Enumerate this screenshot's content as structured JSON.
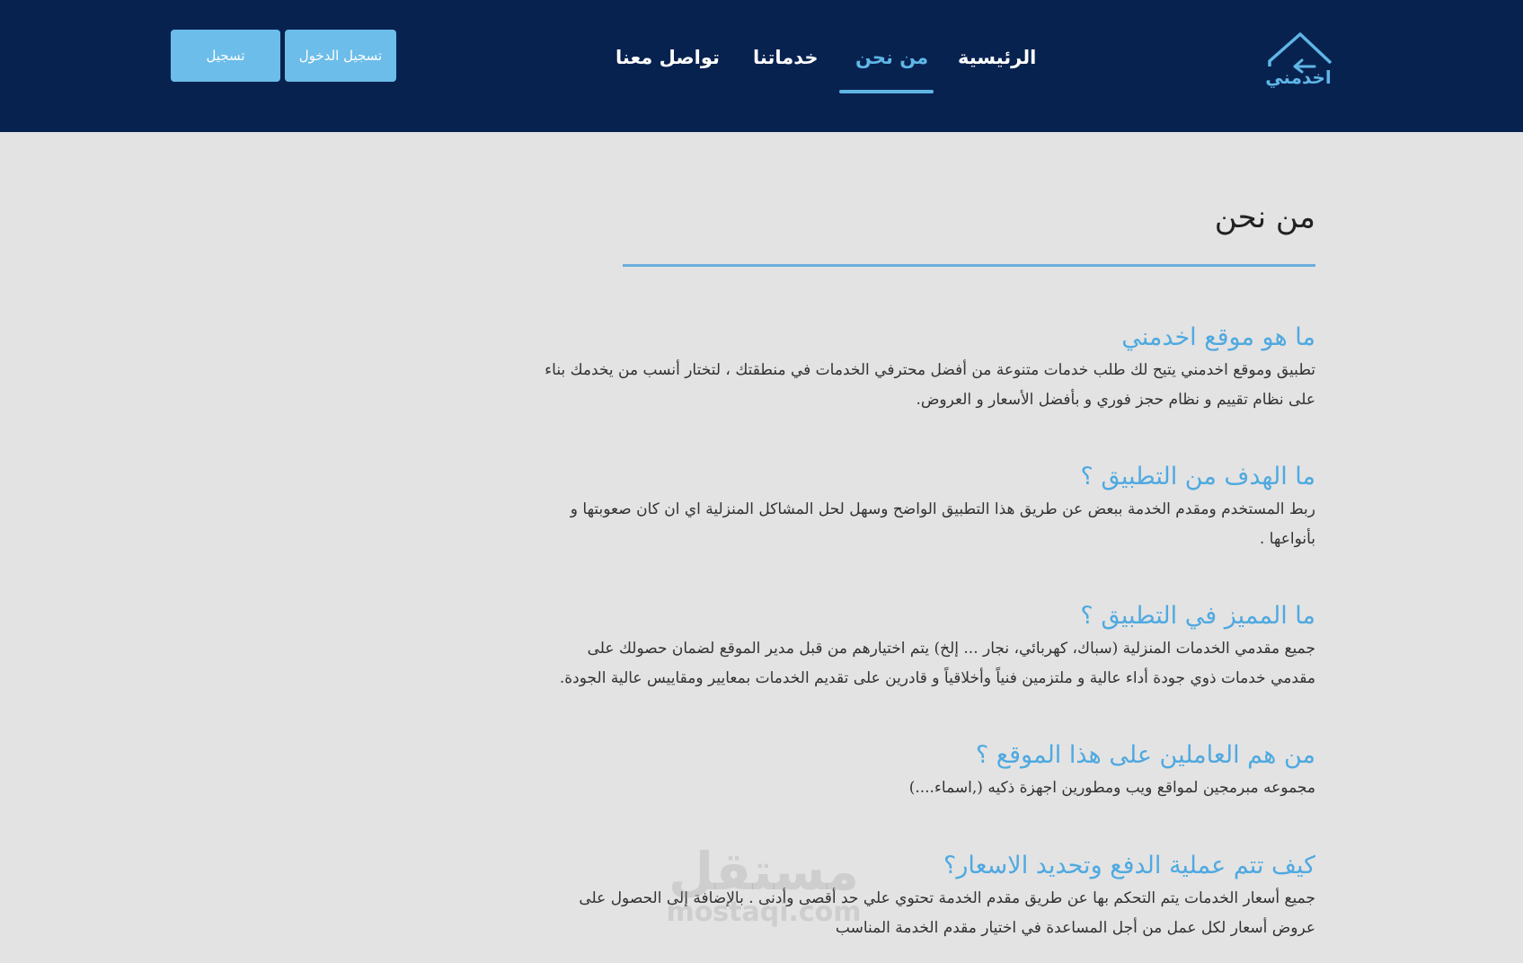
{
  "brand": {
    "logo_text": "اخدمني"
  },
  "nav": {
    "items": [
      {
        "label": "الرئيسية"
      },
      {
        "label": "من نحن"
      },
      {
        "label": "خدماتنا"
      },
      {
        "label": "تواصل معنا"
      }
    ],
    "active": "من نحن"
  },
  "auth": {
    "login_label": "تسجيل الدخول",
    "register_label": "تسجيل"
  },
  "page": {
    "title": "من نحن",
    "sections": [
      {
        "question": "ما هو موقع اخدمني",
        "answer": "تطبيق وموقع اخدمني يتيح لك طلب خدمات متنوعة من أفضل محترفي الخدمات في منطقتك ، لتختار أنسب من يخدمك بناء على نظام تقييم و نظام حجز فوري و بأفضل الأسعار و العروض."
      },
      {
        "question": "ما الهدف من التطبيق ؟",
        "answer": "ربط المستخدم ومقدم الخدمة ببعض عن طريق هذا التطبيق الواضح وسهل لحل المشاكل المنزلية اي ان كان صعوبتها و بأنواعها ."
      },
      {
        "question": "ما المميز في التطبيق ؟",
        "answer": "جميع مقدمي الخدمات المنزلية (سباك، كهربائي، نجار ... إلخ) يتم اختيارهم من قبل مدير الموقع لضمان حصولك على مقدمي خدمات ذوي جودة أداء عالية و ملتزمين فنياً وأخلاقياً و قادرين على تقديم الخدمات بمعايير ومقاييس عالية الجودة."
      },
      {
        "question": "من هم العاملين على هذا الموقع ؟",
        "answer": "مجموعه مبرمجين لمواقع ويب ومطورين اجهزة ذكيه (,اسماء....)"
      },
      {
        "question": "كيف تتم عملية الدفع وتحديد الاسعار؟",
        "answer": "جميع أسعار الخدمات يتم التحكم بها عن طريق مقدم الخدمة تحتوي علي حد أقصى وأدنى . بالإضافة إلى الحصول على عروض أسعار لكل عمل من أجل المساعدة في اختيار مقدم الخدمة المناسب"
      }
    ]
  },
  "watermark": {
    "arabic": "مستقل",
    "latin": "mostaqi.com"
  },
  "colors": {
    "header_bg": "#082250",
    "accent": "#5fb6e6",
    "button_bg": "#6cbde9",
    "page_bg": "#e3e3e3"
  }
}
